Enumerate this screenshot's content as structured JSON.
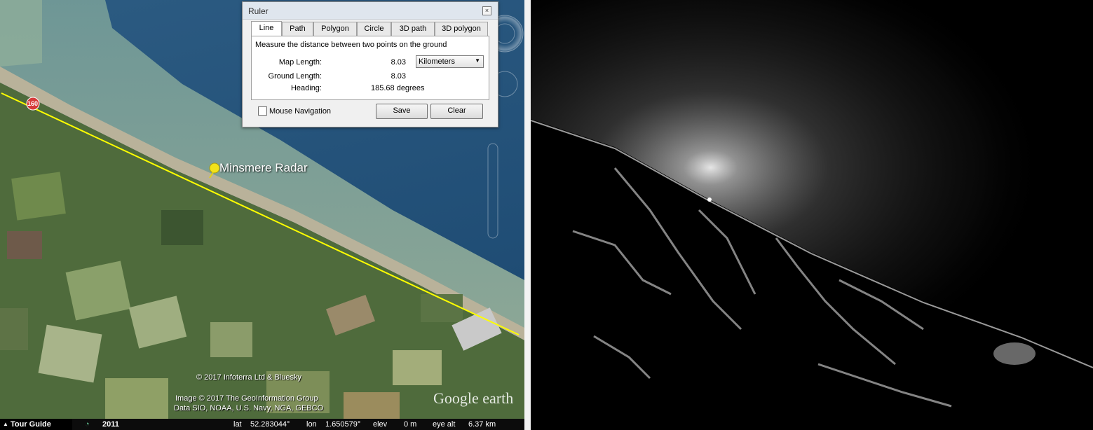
{
  "map": {
    "placemark_label": "Minsmere Radar",
    "road_badge": "160",
    "attribution_1": "© 2017 Infoterra Ltd & Bluesky",
    "attribution_2": "Image © 2017 The GeoInformation Group",
    "attribution_3": "Data SIO, NOAA, U.S. Navy, NGA, GEBCO",
    "logo": "Google earth"
  },
  "ruler": {
    "title": "Ruler",
    "close_glyph": "×",
    "tabs": [
      "Line",
      "Path",
      "Polygon",
      "Circle",
      "3D path",
      "3D polygon"
    ],
    "active_tab": "Line",
    "description": "Measure the distance between two points on the ground",
    "map_length_label": "Map Length:",
    "map_length_value": "8.03",
    "unit": "Kilometers",
    "ground_length_label": "Ground Length:",
    "ground_length_value": "8.03",
    "heading_label": "Heading:",
    "heading_value": "185.68 degrees",
    "mouse_nav_label": "Mouse Navigation",
    "save_label": "Save",
    "clear_label": "Clear"
  },
  "status": {
    "tour_guide": "Tour Guide",
    "year": "2011",
    "lat_label": "lat",
    "lat_value": "52.283044°",
    "lon_label": "lon",
    "lon_value": "1.650579°",
    "elev_label": "elev",
    "elev_value": "0 m",
    "eye_alt_label": "eye alt",
    "eye_alt_value": "6.37 km"
  },
  "colors": {
    "ruler_line": "#ffff00",
    "sea_deep": "#1d4a72",
    "land_green": "#4a6b3a",
    "pin": "#f2e21a"
  }
}
